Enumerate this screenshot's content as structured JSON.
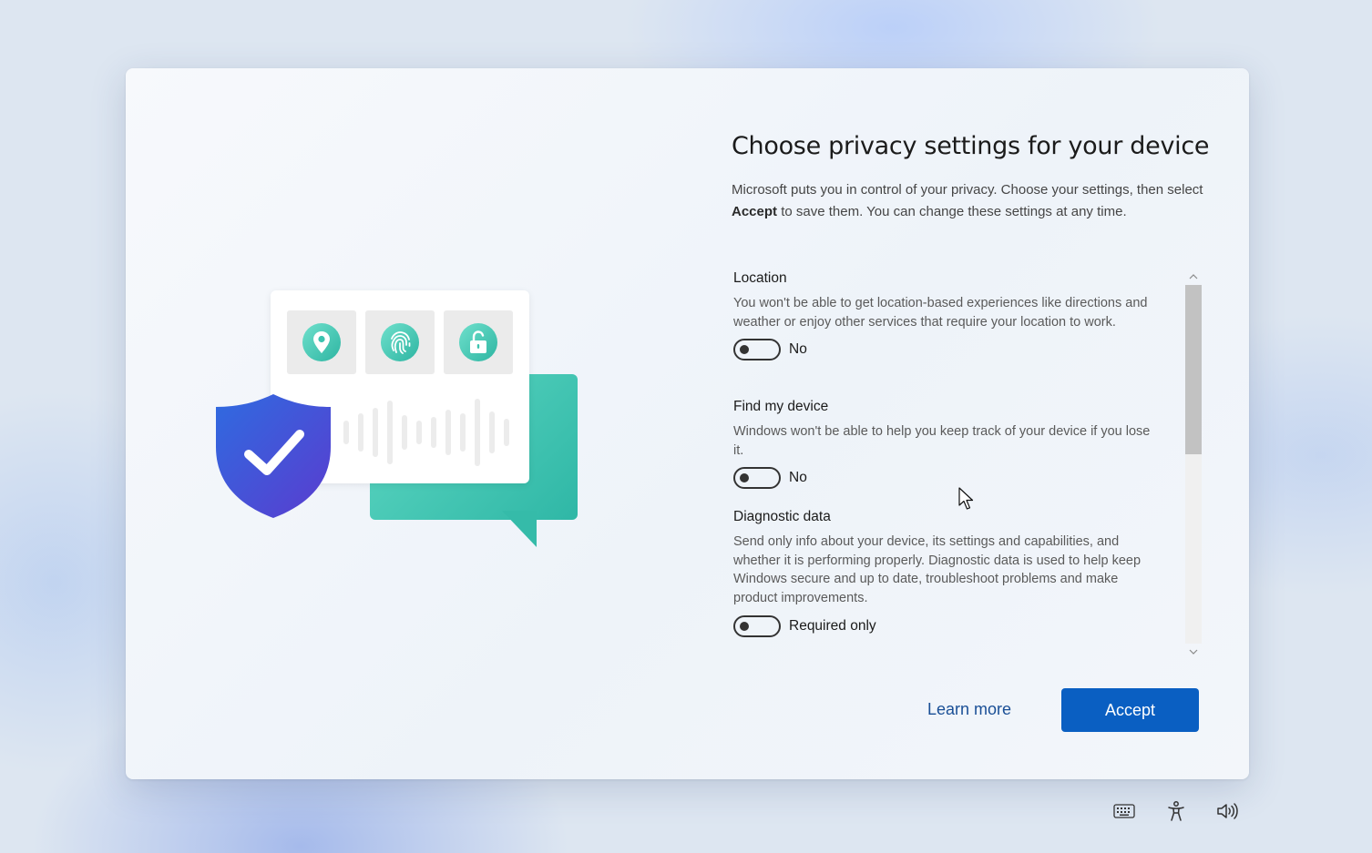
{
  "dialog": {
    "title": "Choose privacy settings for your device",
    "intro_before": "Microsoft puts you in control of your privacy. Choose your settings, then select ",
    "intro_bold": "Accept",
    "intro_after": " to save them. You can change these settings at any time."
  },
  "illustration": {
    "icons": [
      "location-pin-icon",
      "fingerprint-icon",
      "unlocked-padlock-icon",
      "shield-check-icon"
    ]
  },
  "settings": [
    {
      "name": "Location",
      "description": "You won't be able to get location-based experiences like directions and weather or enjoy other services that require your location to work.",
      "toggle_state": "off",
      "toggle_label": "No"
    },
    {
      "name": "Find my device",
      "description": "Windows won't be able to help you keep track of your device if you lose it.",
      "toggle_state": "off",
      "toggle_label": "No"
    },
    {
      "name": "Diagnostic data",
      "description": "Send only info about your device, its settings and capabilities, and whether it is performing properly. Diagnostic data is used to help keep Windows secure and up to date, troubleshoot problems and make product improvements.",
      "toggle_state": "off",
      "toggle_label": "Required only"
    }
  ],
  "actions": {
    "learn_more": "Learn more",
    "accept": "Accept"
  },
  "tray": {
    "icons": [
      "keyboard-icon",
      "accessibility-icon",
      "volume-icon"
    ]
  },
  "colors": {
    "accent": "#0a5fc2",
    "link": "#1a4f96",
    "teal": "#2fb7a6",
    "shield": "#3a4fd8"
  }
}
